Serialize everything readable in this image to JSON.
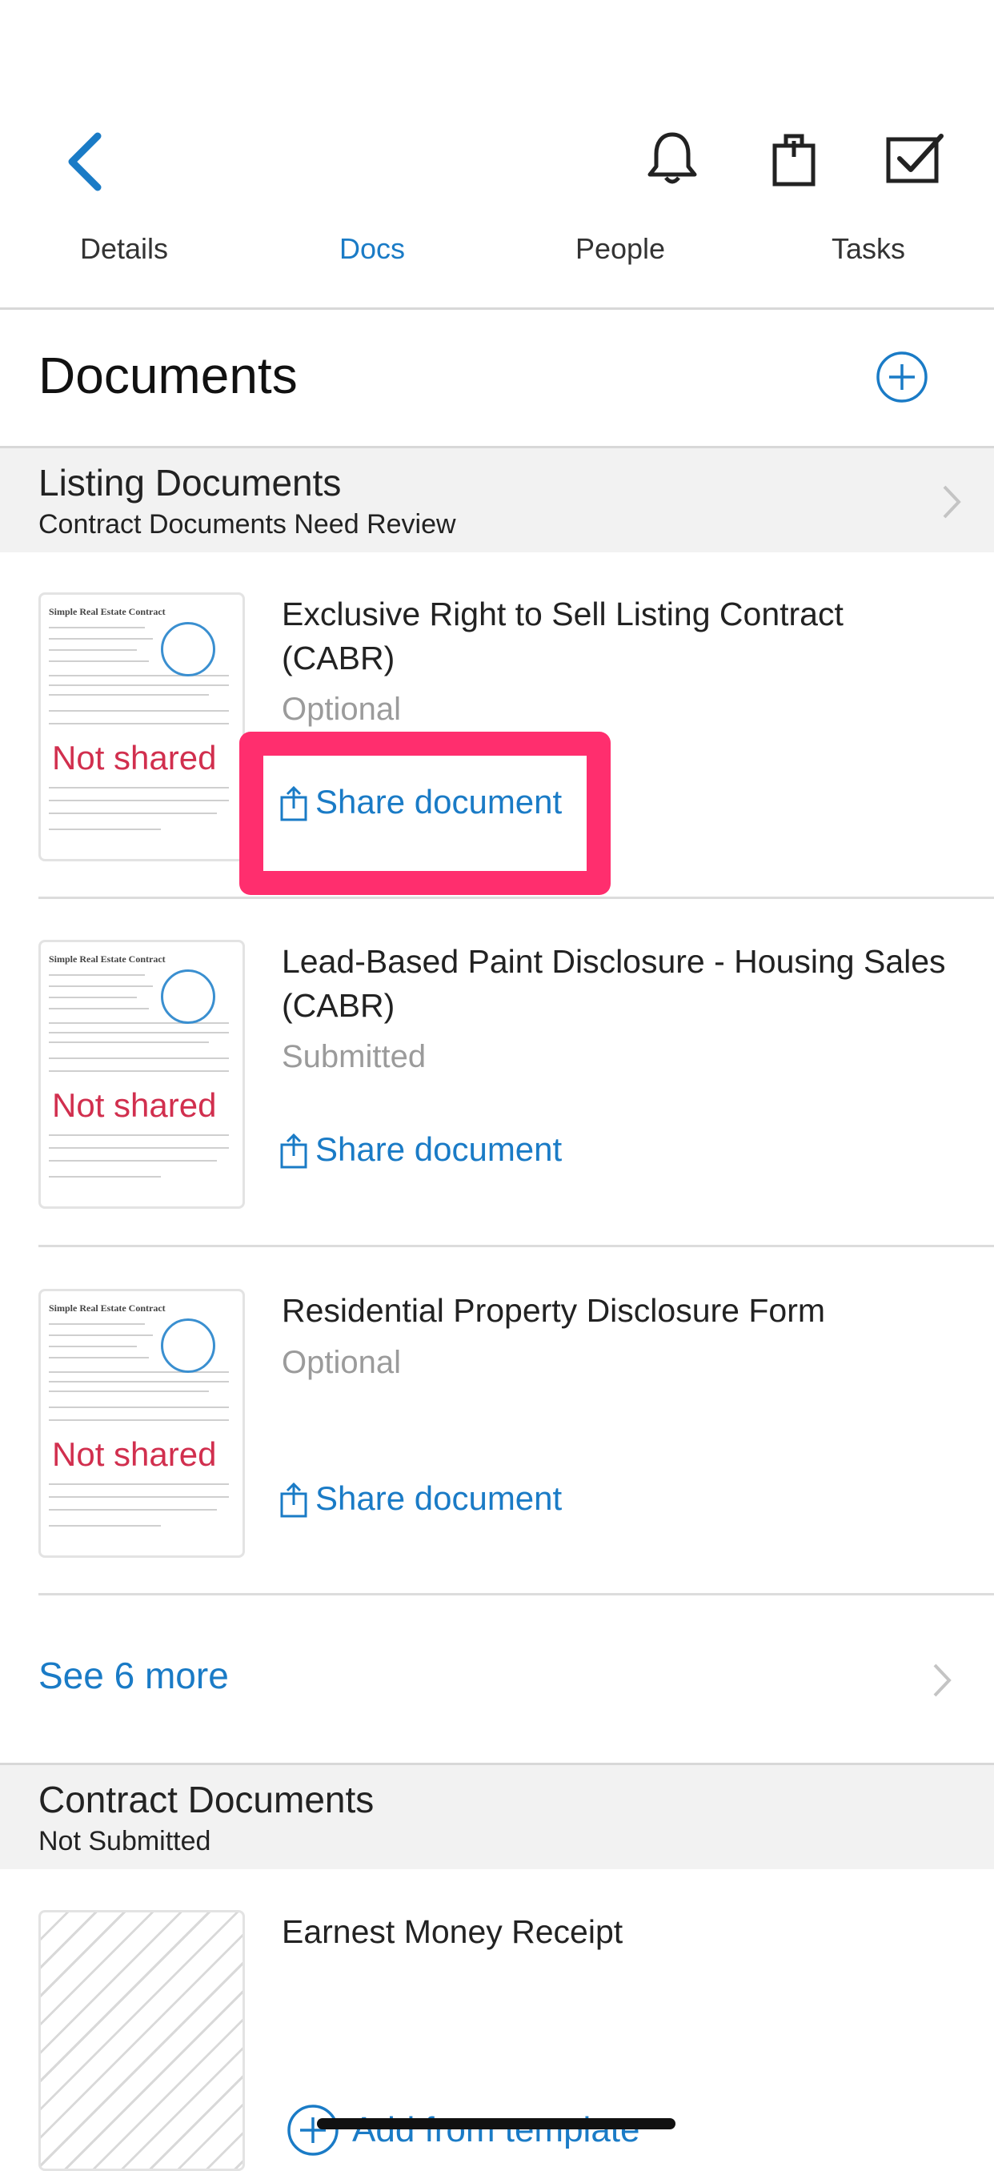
{
  "nav": {
    "tabs": [
      "Details",
      "Docs",
      "People",
      "Tasks"
    ],
    "active_tab": "Docs"
  },
  "page": {
    "title": "Documents"
  },
  "sections": [
    {
      "title": "Listing Documents",
      "subtitle": "Contract Documents Need Review",
      "documents": [
        {
          "title": "Exclusive Right to Sell Listing Contract (CABR)",
          "status": "Optional",
          "badge": "Not shared",
          "action": "Share document"
        },
        {
          "title": "Lead-Based Paint Disclosure - Housing Sales (CABR)",
          "status": "Submitted",
          "badge": "Not shared",
          "action": "Share document"
        },
        {
          "title": "Residential Property Disclosure Form",
          "status": "Optional",
          "badge": "Not shared",
          "action": "Share document"
        }
      ],
      "see_more": "See 6 more"
    },
    {
      "title": "Contract Documents",
      "subtitle": "Not Submitted",
      "documents": [
        {
          "title": "Earnest Money Receipt",
          "action": "Add from template"
        }
      ]
    }
  ],
  "thumbnail": {
    "doc_heading": "Simple Real Estate Contract"
  },
  "colors": {
    "accent": "#1a7bc6",
    "not_shared": "#d12f4e",
    "highlight": "#ff2e6e"
  }
}
